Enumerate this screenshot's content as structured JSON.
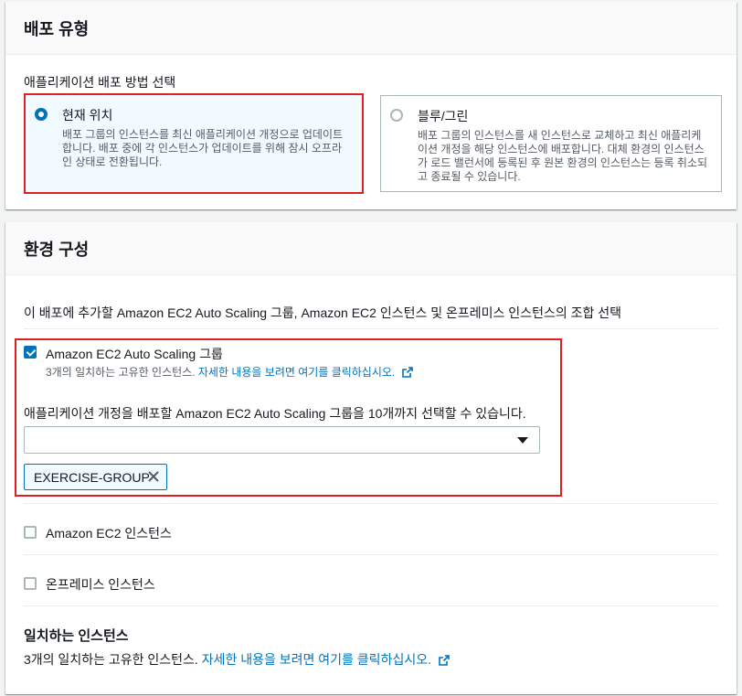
{
  "deployment_type": {
    "title": "배포 유형",
    "method_label": "애플리케이션 배포 방법 선택",
    "options": [
      {
        "title": "현재 위치",
        "description": "배포 그룹의 인스턴스를 최신 애플리케이션 개정으로 업데이트합니다. 배포 중에 각 인스턴스가 업데이트를 위해 잠시 오프라인 상태로 전환됩니다.",
        "selected": true
      },
      {
        "title": "블루/그린",
        "description": "배포 그룹의 인스턴스를 새 인스턴스로 교체하고 최신 애플리케이션 개정을 해당 인스턴스에 배포합니다. 대체 환경의 인스턴스가 로드 밸런서에 등록된 후 원본 환경의 인스턴스는 등록 취소되고 종료될 수 있습니다.",
        "selected": false
      }
    ]
  },
  "environment": {
    "title": "환경 구성",
    "description": "이 배포에 추가할 Amazon EC2 Auto Scaling 그룹, Amazon EC2 인스턴스 및 온프레미스 인스턴스의 조합 선택",
    "asg": {
      "label": "Amazon EC2 Auto Scaling 그룹",
      "checked": true,
      "match_text": "3개의 일치하는 고유한 인스턴스.",
      "match_link": "자세한 내용을 보려면 여기를 클릭하십시오.",
      "select_label": "애플리케이션 개정을 배포할 Amazon EC2 Auto Scaling 그룹을 10개까지 선택할 수 있습니다.",
      "select_value": "",
      "tokens": [
        "EXERCISE-GROUP"
      ]
    },
    "ec2": {
      "label": "Amazon EC2 인스턴스",
      "checked": false
    },
    "onprem": {
      "label": "온프레미스 인스턴스",
      "checked": false
    },
    "matching": {
      "title": "일치하는 인스턴스",
      "text": "3개의 일치하는 고유한 인스턴스.",
      "link": "자세한 내용을 보려면 여기를 클릭하십시오."
    }
  },
  "colors": {
    "accent": "#0073bb",
    "highlight_border": "#e02020",
    "selected_bg": "#f1faff"
  }
}
